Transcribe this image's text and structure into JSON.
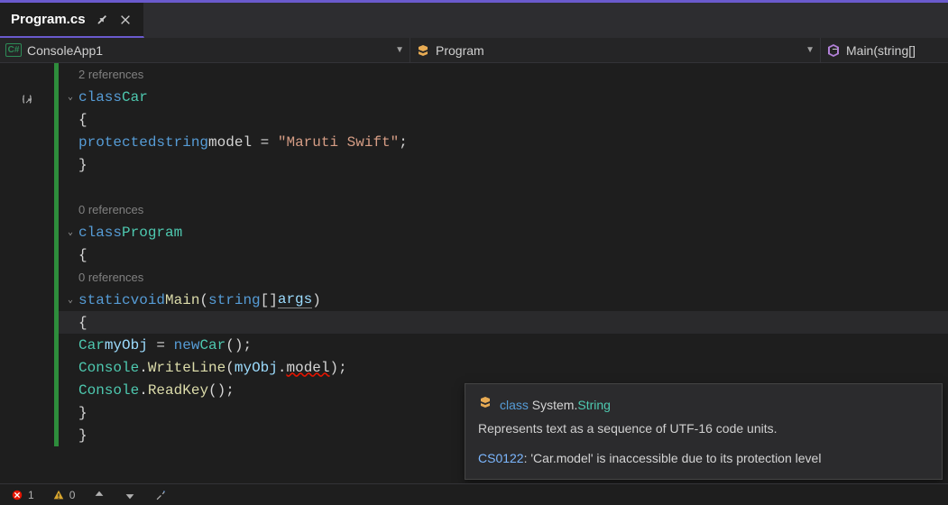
{
  "tab": {
    "title": "Program.cs"
  },
  "breadcrumb": {
    "project_badge": "C#",
    "project": "ConsoleApp1",
    "class": "Program",
    "method": "Main(string[]"
  },
  "codelens": {
    "car": "2 references",
    "program": "0 references",
    "main": "0 references"
  },
  "code": {
    "class_kw": "class",
    "car": "Car",
    "open_brace": "{",
    "close_brace": "}",
    "protected": "protected",
    "string": "string",
    "model_decl": "model",
    "eq": " = ",
    "model_value": "\"Maruti Swift\"",
    "semi": ";",
    "program": "Program",
    "static": "static",
    "void": "void",
    "main": "Main",
    "lparen": "(",
    "rparen": ")",
    "string_arr": "string",
    "brackets": "[]",
    "args": "args",
    "car_type": "Car",
    "myObj": "myObj",
    "new": "new",
    "car_ctor": "Car",
    "empty_parens": "()",
    "console": "Console",
    "dot": ".",
    "writeline": "WriteLine",
    "model_err": "model",
    "readkey": "ReadKey"
  },
  "tooltip": {
    "class_kw": "class",
    "namespace": "System.",
    "typename": "String",
    "description": "Represents text as a sequence of UTF-16 code units.",
    "error_code": "CS0122",
    "error_msg": ": 'Car.model' is inaccessible due to its protection level"
  },
  "status": {
    "errors": "1",
    "warnings": "0",
    "up": "↑",
    "down": "↓"
  }
}
